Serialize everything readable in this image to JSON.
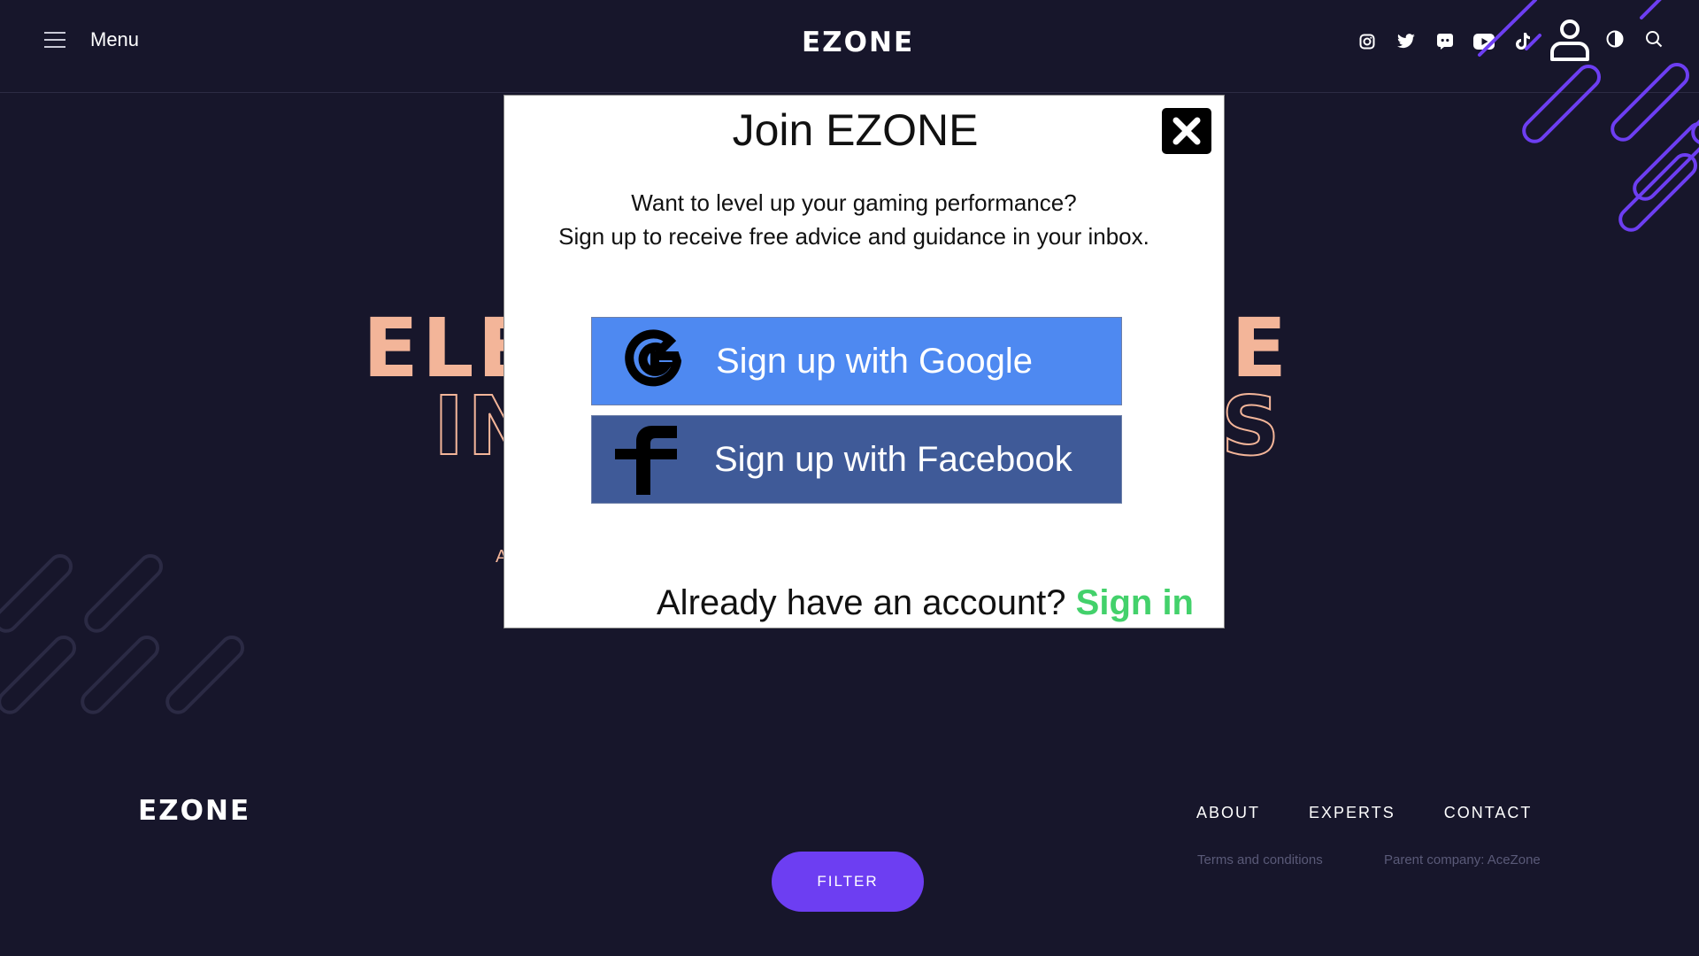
{
  "header": {
    "menu_label": "Menu",
    "logo": "EZONE",
    "social_icons": [
      "instagram-icon",
      "twitter-icon",
      "discord-icon",
      "youtube-icon",
      "tiktok-icon"
    ],
    "extra_icons": [
      "user-icon",
      "contrast-icon",
      "search-icon"
    ]
  },
  "hero": {
    "line1_left": "ELEV",
    "line1_right": "ICE",
    "line2_left": "IN",
    "line2_right": "S",
    "small_text": "A"
  },
  "modal": {
    "title": "Join EZONE",
    "description_line1": "Want to level up your gaming performance?",
    "description_line2": "Sign up to receive free advice and guidance in your inbox.",
    "google_label": "Sign up with Google",
    "facebook_label": "Sign up with Facebook",
    "signin_prompt": "Already have an account?",
    "signin_link": "Sign in",
    "colors": {
      "google": "#4e89f1",
      "facebook": "#3f5a98",
      "signin": "#43d16b"
    }
  },
  "footer": {
    "logo": "EZONE",
    "nav": [
      "ABOUT",
      "EXPERTS",
      "CONTACT"
    ],
    "terms": "Terms and conditions",
    "parent_company": "Parent company: AceZone",
    "filter_label": "FILTER"
  },
  "colors": {
    "background": "#17162b",
    "accent": "#6d3ef2",
    "hero_text": "#f3b599"
  }
}
